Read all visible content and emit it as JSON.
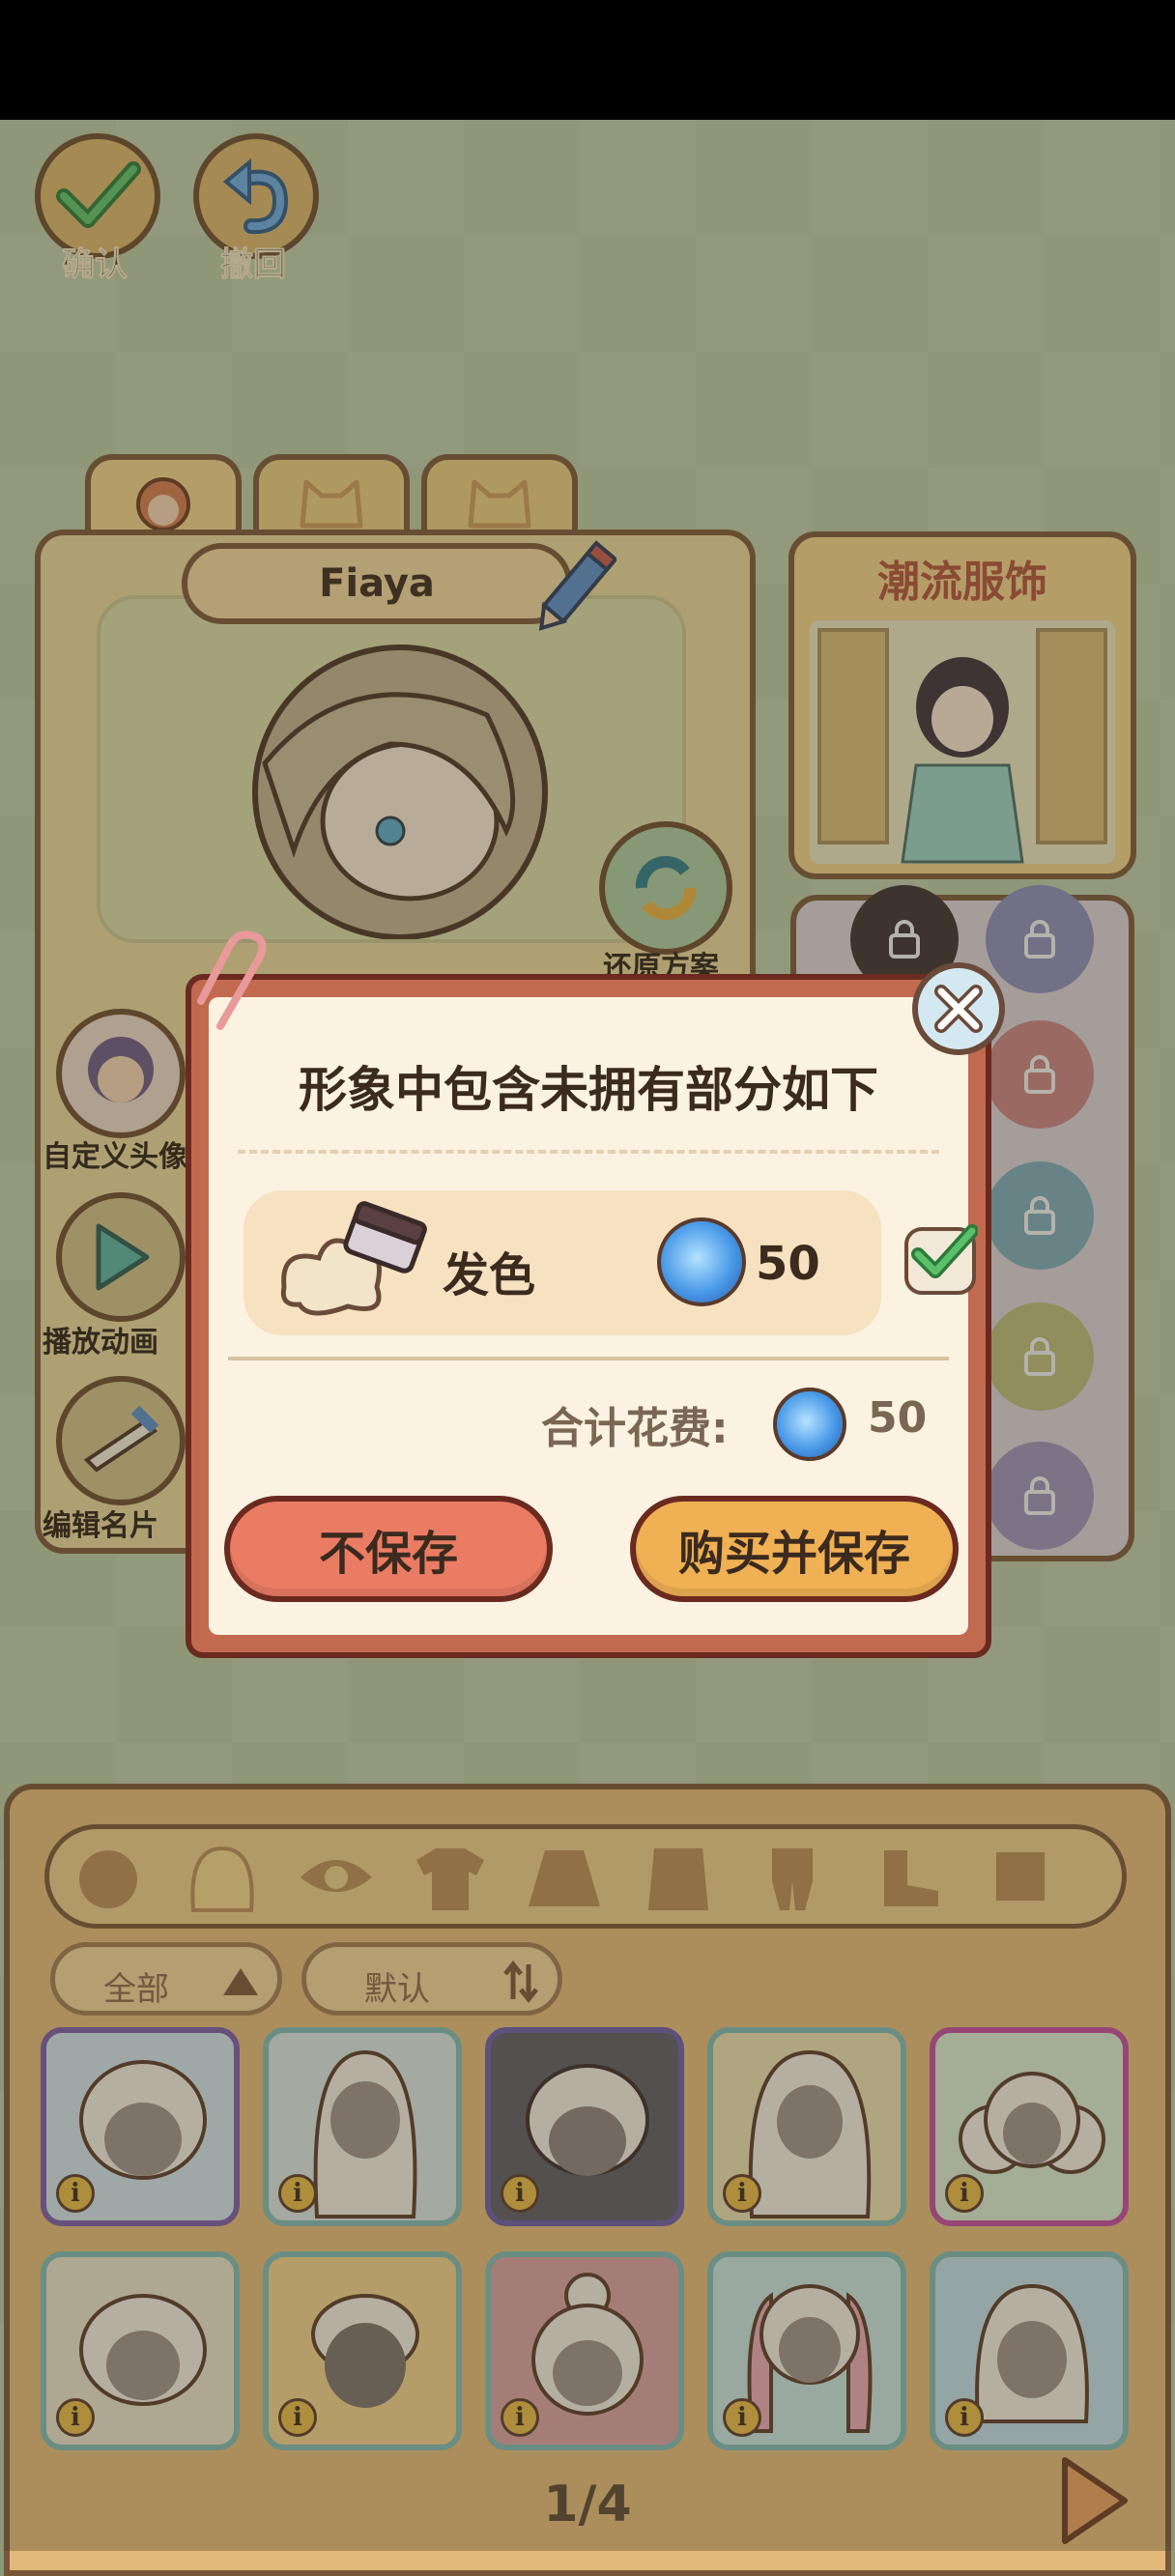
{
  "top_actions": {
    "confirm_label": "确认",
    "undo_label": "撤回"
  },
  "character": {
    "name": "Fiaya",
    "restore_label": "还原方案"
  },
  "side_actions": {
    "custom_avatar_label": "自定义头像",
    "play_anim_label": "播放动画",
    "edit_card_label": "编辑名片"
  },
  "fashion": {
    "title": "潮流服饰"
  },
  "modal": {
    "title": "形象中包含未拥有部分如下",
    "item": {
      "name": "发色",
      "price": "50",
      "icon": "hair-dye-icon",
      "selected": true
    },
    "total_label": "合计花费:",
    "total_value": "50",
    "cancel_label": "不保存",
    "confirm_label": "购买并保存"
  },
  "wardrobe": {
    "filter_all": "全部",
    "filter_sort": "默认",
    "page_indicator": "1/4",
    "tile_info": "i"
  },
  "colors": {
    "accent_button": "#f0b054",
    "cancel_button": "#ea7c64",
    "gem": "#4a9ae8"
  }
}
